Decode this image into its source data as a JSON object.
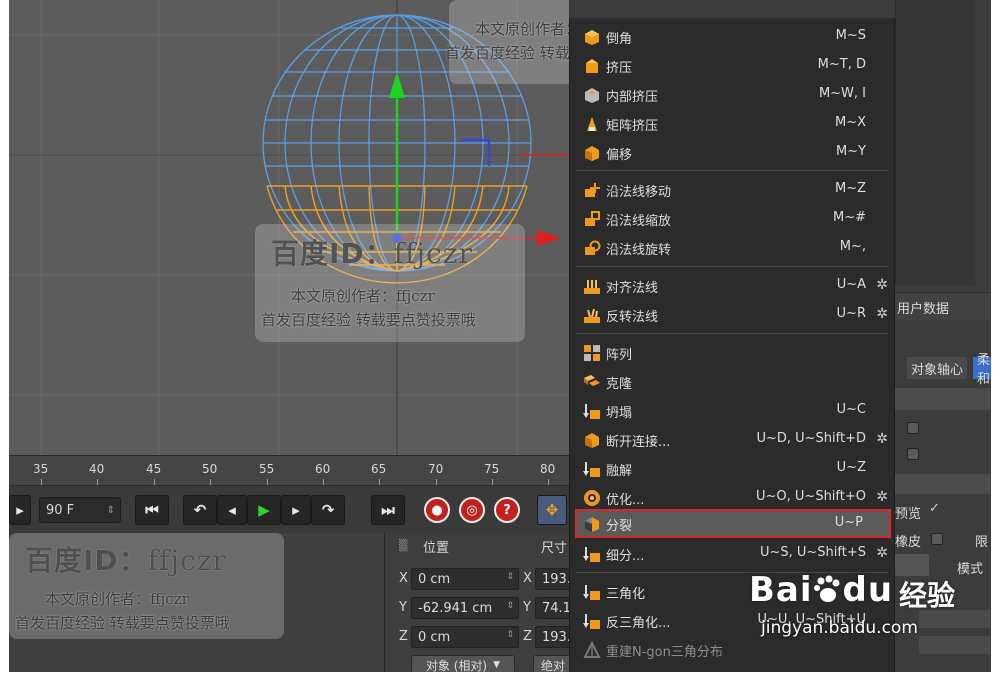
{
  "timeline": {
    "ticks": [
      "35",
      "40",
      "45",
      "50",
      "55",
      "60",
      "65",
      "70",
      "75",
      "80"
    ]
  },
  "transport": {
    "frame_value": "90 F",
    "frame_stepper": "⇕"
  },
  "coordinates": {
    "position_header": "位置",
    "size_header": "尺寸",
    "axis_x": "X",
    "axis_y": "Y",
    "axis_z": "Z",
    "pos_x": "0 cm",
    "pos_y": "-62.941 cm",
    "pos_z": "0 cm",
    "size_x": "193.1",
    "size_y": "74.11",
    "size_z": "193.1",
    "mode_dropdown": "对象 (相对)",
    "abs_button": "绝对"
  },
  "menu": {
    "items": [
      {
        "label": "倒角",
        "key": "M~S",
        "icon": "bevel-icon"
      },
      {
        "label": "挤压",
        "key": "M~T, D",
        "icon": "extrude-icon"
      },
      {
        "label": "内部挤压",
        "key": "M~W, I",
        "icon": "extrude-inner-icon"
      },
      {
        "label": "矩阵挤压",
        "key": "M~X",
        "icon": "matrix-extrude-icon"
      },
      {
        "label": "偏移",
        "key": "M~Y",
        "icon": "offset-icon"
      },
      {
        "label": "沿法线移动",
        "key": "M~Z",
        "icon": "normal-move-icon"
      },
      {
        "label": "沿法线缩放",
        "key": "M~#",
        "icon": "normal-scale-icon"
      },
      {
        "label": "沿法线旋转",
        "key": "M~,",
        "icon": "normal-rotate-icon"
      },
      {
        "label": "对齐法线",
        "key": "U~A",
        "icon": "align-normals-icon"
      },
      {
        "label": "反转法线",
        "key": "U~R",
        "icon": "reverse-normals-icon"
      },
      {
        "label": "阵列",
        "key": "",
        "icon": "array-icon"
      },
      {
        "label": "克隆",
        "key": "",
        "icon": "clone-icon"
      },
      {
        "label": "坍塌",
        "key": "U~C",
        "icon": "collapse-icon"
      },
      {
        "label": "断开连接...",
        "key": "U~D, U~Shift+D",
        "icon": "disconnect-icon"
      },
      {
        "label": "融解",
        "key": "U~Z",
        "icon": "melt-icon"
      },
      {
        "label": "优化...",
        "key": "U~O, U~Shift+O",
        "icon": "optimize-icon"
      },
      {
        "label": "分裂",
        "key": "U~P",
        "icon": "split-icon"
      },
      {
        "label": "细分...",
        "key": "U~S, U~Shift+S",
        "icon": "subdivide-icon"
      },
      {
        "label": "三角化",
        "key": "",
        "icon": "triangulate-icon"
      },
      {
        "label": "反三角化...",
        "key": "U~U, U~Shift+U",
        "icon": "untriangulate-icon"
      },
      {
        "label": "重建N-gon三角分布",
        "key": "",
        "icon": "retriangulate-ngons-icon"
      }
    ],
    "gear_glyph": "✲"
  },
  "right_panel": {
    "user_data_tab": "用户数据",
    "object_axis_tab": "对象轴心",
    "soft_tab": "柔和",
    "preview_label": "预览",
    "preview_check": "✓",
    "rubber_label": "橡皮",
    "mode_label": "模式",
    "side_letter": "限"
  },
  "watermark": {
    "id_prefix": "百度ID：",
    "id_name": "ffjczr",
    "line1": "本文原创作者：ffjczr",
    "line2": "首发百度经验  转载要点赞投票哦"
  },
  "baidu": {
    "brand": "Bai",
    "brand_du": "du",
    "jingyan": "经验",
    "url": "jingyan.baidu.com"
  },
  "colors": {
    "highlight_border": "#d8262a",
    "sphere_blue": "#5a9fe6",
    "sphere_orange": "#f0a020",
    "axis_green": "#1ed41e",
    "axis_red": "#e01e1e"
  }
}
